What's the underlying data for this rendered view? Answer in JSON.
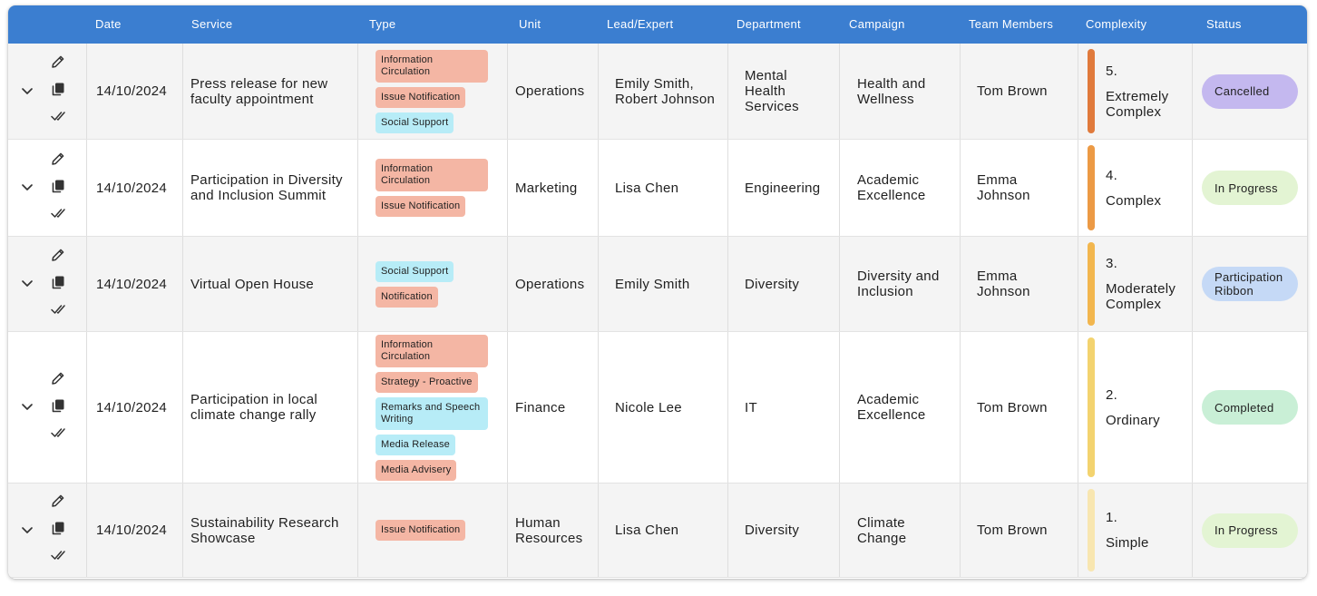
{
  "columns": {
    "date": "Date",
    "service": "Service",
    "type": "Type",
    "unit": "Unit",
    "lead": "Lead/Expert",
    "department": "Department",
    "campaign": "Campaign",
    "team": "Team Members",
    "complexity": "Complexity",
    "status": "Status"
  },
  "colors": {
    "header": "#3b7ed0",
    "chip_salmon": "#f4b6a4",
    "chip_cyan": "#b7ecf7"
  },
  "icons": {
    "expand": "chevron-down-icon",
    "edit": "pencil-icon",
    "duplicate": "copy-icon",
    "approve": "double-check-icon"
  },
  "rows": [
    {
      "date": "14/10/2024",
      "service": "Press release for new faculty appointment",
      "types": [
        {
          "label": "Information Circulation",
          "color": "salmon"
        },
        {
          "label": "Issue Notification",
          "color": "salmon"
        },
        {
          "label": "Social Support",
          "color": "cyan"
        }
      ],
      "unit": "Operations",
      "lead": "Emily Smith, Robert Johnson",
      "department": "Mental Health Services",
      "campaign": "Health and Wellness",
      "team": "Tom Brown",
      "complexity": {
        "level": "5.",
        "label": "Extremely Complex",
        "color": "#e07a3c"
      },
      "status": {
        "label": "Cancelled",
        "color": "#c4b8ef"
      }
    },
    {
      "date": "14/10/2024",
      "service": "Participation in Diversity and Inclusion Summit",
      "types": [
        {
          "label": "Information Circulation",
          "color": "salmon"
        },
        {
          "label": "Issue Notification",
          "color": "salmon"
        }
      ],
      "unit": "Marketing",
      "lead": "Lisa Chen",
      "department": "Engineering",
      "campaign": "Academic Excellence",
      "team": "Emma Johnson",
      "complexity": {
        "level": "4.",
        "label": "Complex",
        "color": "#ec9a45"
      },
      "status": {
        "label": "In Progress",
        "color": "#e3f4d3"
      }
    },
    {
      "date": "14/10/2024",
      "service": "Virtual Open House",
      "types": [
        {
          "label": "Social Support",
          "color": "cyan"
        },
        {
          "label": "Notification",
          "color": "salmon"
        }
      ],
      "unit": "Operations",
      "lead": "Emily Smith",
      "department": "Diversity",
      "campaign": "Diversity and Inclusion",
      "team": "Emma Johnson",
      "complexity": {
        "level": "3.",
        "label": "Moderately Complex",
        "color": "#f2b64e"
      },
      "status": {
        "label": "Participation Ribbon",
        "color": "#c5d9f6"
      }
    },
    {
      "date": "14/10/2024",
      "service": "Participation in local climate change rally",
      "types": [
        {
          "label": "Information Circulation",
          "color": "salmon"
        },
        {
          "label": "Strategy - Proactive",
          "color": "salmon"
        },
        {
          "label": "Remarks and Speech Writing",
          "color": "cyan"
        },
        {
          "label": "Media Release",
          "color": "cyan"
        },
        {
          "label": "Media Advisery",
          "color": "salmon"
        }
      ],
      "unit": "Finance",
      "lead": "Nicole Lee",
      "department": "IT",
      "campaign": "Academic Excellence",
      "team": "Tom Brown",
      "complexity": {
        "level": "2.",
        "label": "Ordinary",
        "color": "#f3d36f"
      },
      "status": {
        "label": "Completed",
        "color": "#c9efd6"
      }
    },
    {
      "date": "14/10/2024",
      "service": "Sustainability Research Showcase",
      "types": [
        {
          "label": "Issue Notification",
          "color": "salmon"
        }
      ],
      "unit": "Human Resources",
      "lead": "Lisa Chen",
      "department": "Diversity",
      "campaign": "Climate Change",
      "team": "Tom Brown",
      "complexity": {
        "level": "1.",
        "label": "Simple",
        "color": "#f8e6b0"
      },
      "status": {
        "label": "In Progress",
        "color": "#e3f4d3"
      }
    }
  ]
}
